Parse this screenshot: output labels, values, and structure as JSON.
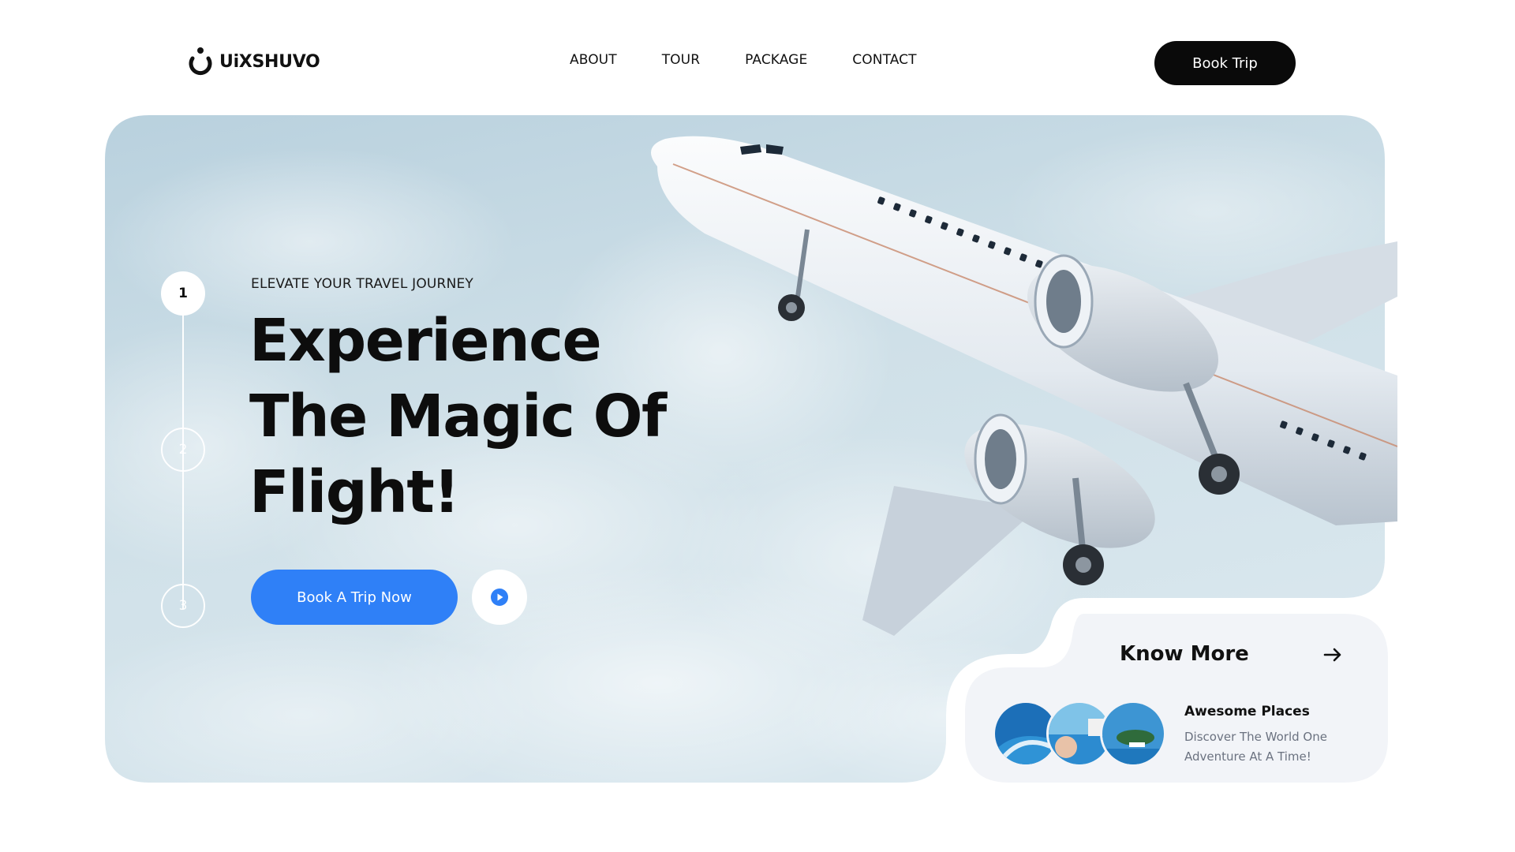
{
  "brand": {
    "name": "UiXSHUVO"
  },
  "nav": {
    "items": [
      {
        "label": "ABOUT"
      },
      {
        "label": "TOUR"
      },
      {
        "label": "PACKAGE"
      },
      {
        "label": "CONTACT"
      }
    ],
    "cta_label": "Book Trip"
  },
  "hero": {
    "steps": [
      {
        "label": "1",
        "active": true
      },
      {
        "label": "2",
        "active": false
      },
      {
        "label": "3",
        "active": false
      }
    ],
    "eyebrow": "ELEVATE YOUR TRAVEL JOURNEY",
    "headline_lines": [
      "Experience",
      "The Magic Of",
      "Flight!"
    ],
    "primary_cta": "Book A Trip Now",
    "play_icon": "play-icon",
    "image_subject": "airplane-in-clouds"
  },
  "know_more": {
    "title": "Know More",
    "arrow_icon": "arrow-right-icon",
    "places_title": "Awesome Places",
    "places_desc": "Discover The World One Adventure At A Time!"
  },
  "colors": {
    "accent_blue": "#2f80f7",
    "button_black": "#0a0a0a",
    "sky": "#c9dde7",
    "card_bg": "#f2f4f8"
  }
}
